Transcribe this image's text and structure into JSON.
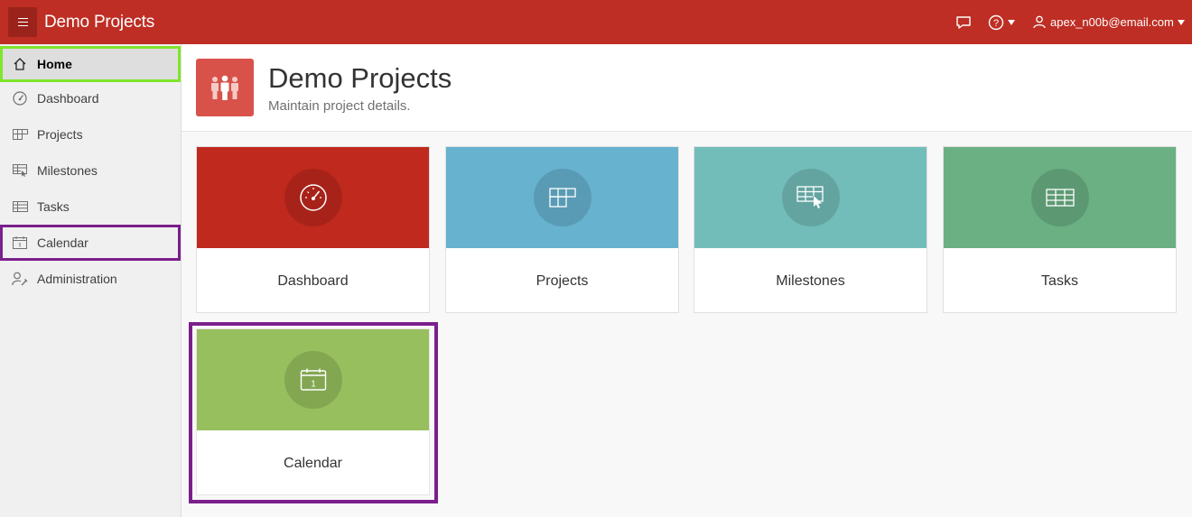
{
  "header": {
    "app_title": "Demo Projects",
    "user": "apex_n00b@email.com",
    "help_icon": "?",
    "background": "#be2e24"
  },
  "sidebar": {
    "items": [
      {
        "label": "Home",
        "icon": "home-icon"
      },
      {
        "label": "Dashboard",
        "icon": "gauge-icon"
      },
      {
        "label": "Projects",
        "icon": "grid-icon"
      },
      {
        "label": "Milestones",
        "icon": "grid-pointer-icon"
      },
      {
        "label": "Tasks",
        "icon": "table-icon"
      },
      {
        "label": "Calendar",
        "icon": "calendar-icon"
      },
      {
        "label": "Administration",
        "icon": "user-wrench-icon"
      }
    ]
  },
  "page": {
    "title": "Demo Projects",
    "subtitle": "Maintain project details."
  },
  "cards": [
    {
      "label": "Dashboard",
      "icon": "gauge-icon",
      "color": "#c0291d"
    },
    {
      "label": "Projects",
      "icon": "grid-icon",
      "color": "#67b2cf"
    },
    {
      "label": "Milestones",
      "icon": "grid-pointer-icon",
      "color": "#72bdb9"
    },
    {
      "label": "Tasks",
      "icon": "table-icon",
      "color": "#6ab083"
    },
    {
      "label": "Calendar",
      "icon": "calendar-icon",
      "color": "#97bf5e",
      "calendar_day": "1"
    }
  ],
  "highlight_colors": {
    "green": "#7fe62b",
    "purple": "#7a1f8b"
  }
}
